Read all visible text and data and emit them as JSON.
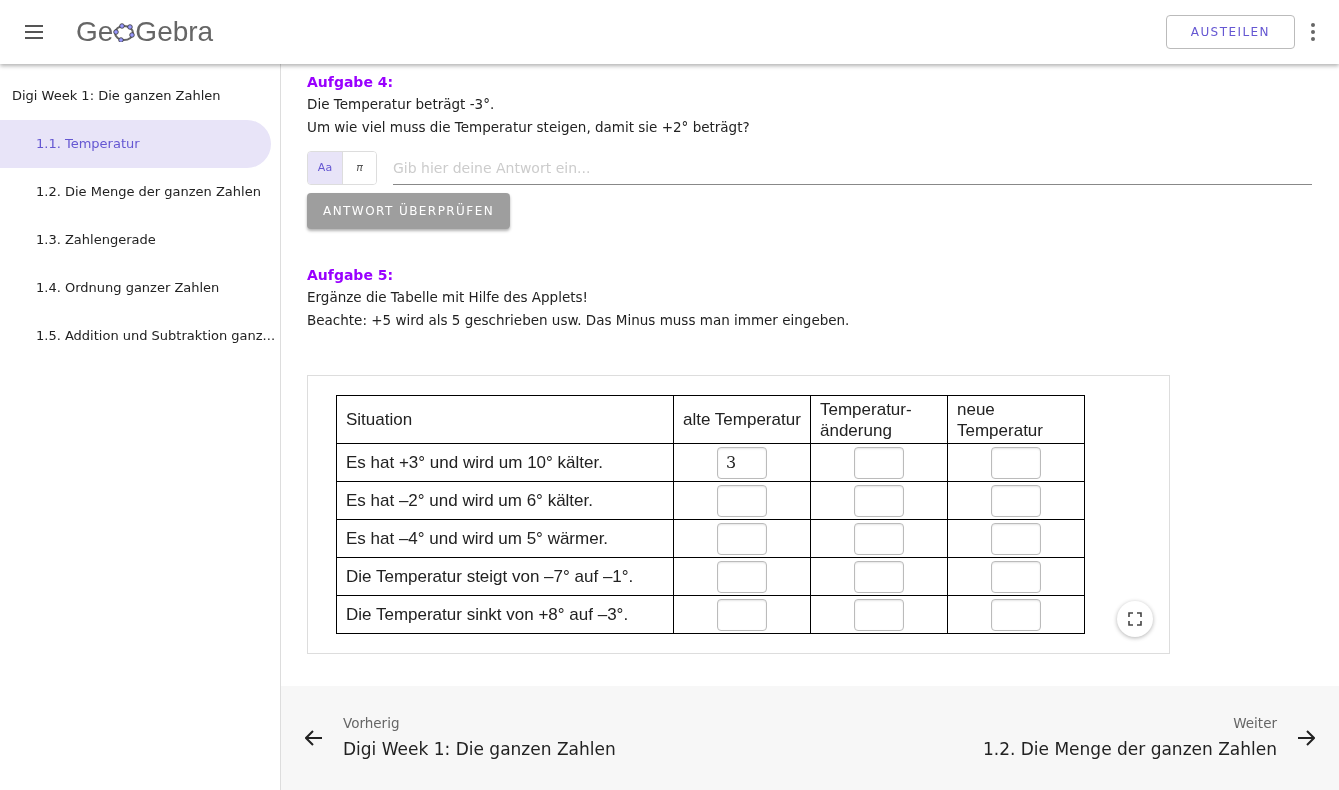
{
  "header": {
    "logo": {
      "before": "Ge",
      "after": "Gebra"
    },
    "share_button": "AUSTEILEN"
  },
  "sidebar": {
    "title": "Digi Week 1: Die ganzen Zahlen",
    "items": [
      {
        "label": "1.1. Temperatur",
        "selected": true
      },
      {
        "label": "1.2. Die Menge der ganzen Zahlen",
        "selected": false
      },
      {
        "label": "1.3. Zahlengerade",
        "selected": false
      },
      {
        "label": "1.4. Ordnung ganzer Zahlen",
        "selected": false
      },
      {
        "label": "1.5. Addition und Subtraktion ganz...",
        "selected": false
      }
    ]
  },
  "task4": {
    "heading": "Aufgabe 4:",
    "lines": [
      "Die Temperatur beträgt -3°.",
      "Um wie viel muss die Temperatur steigen, damit sie +2° beträgt?"
    ],
    "modes": [
      {
        "label": "Aa",
        "selected": true
      },
      {
        "label": "π",
        "selected": false
      }
    ],
    "answer": {
      "placeholder": "Gib hier deine Antwort ein..."
    },
    "check_button": "ANTWORT ÜBERPRÜFEN"
  },
  "task5": {
    "heading": "Aufgabe 5:",
    "lines": [
      "Ergänze die Tabelle mit Hilfe des Applets!",
      "Beachte: +5 wird als 5 geschrieben usw. Das Minus muss man immer eingeben."
    ],
    "applet": {
      "columns": [
        "Situation",
        "alte Temperatur",
        "Temperatur-änderung",
        "neue Temperatur"
      ],
      "rows": [
        {
          "situation": "Es hat +3° und wird um 10° kälter.",
          "values": [
            "3"
          ]
        },
        {
          "situation": "Es hat –2° und wird um 6° kälter."
        },
        {
          "situation": "Es hat –4° und wird um 5° wärmer."
        },
        {
          "situation": "Die Temperatur steigt von –7° auf –1°."
        },
        {
          "situation": "Die Temperatur sinkt von +8° auf –3°."
        }
      ]
    }
  },
  "navigation": {
    "previous": {
      "label": "Vorherig",
      "title": "Digi Week 1: Die ganzen Zahlen"
    },
    "next": {
      "label": "Weiter",
      "title": "1.2. Die Menge der ganzen Zahlen"
    }
  }
}
